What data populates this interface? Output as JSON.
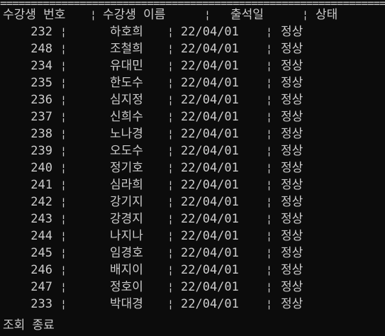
{
  "header": {
    "rule": "======================================================================================================",
    "col_id": "수강생 번호",
    "col_name": "수강생 이름",
    "col_date": "출석일",
    "col_status": "상태",
    "sep": "¦"
  },
  "rows": [
    {
      "id": "232",
      "name": "하호희",
      "date": "22/04/01",
      "status": "정상"
    },
    {
      "id": "248",
      "name": "조철희",
      "date": "22/04/01",
      "status": "정상"
    },
    {
      "id": "234",
      "name": "유대민",
      "date": "22/04/01",
      "status": "정상"
    },
    {
      "id": "235",
      "name": "한도수",
      "date": "22/04/01",
      "status": "정상"
    },
    {
      "id": "236",
      "name": "심지정",
      "date": "22/04/01",
      "status": "정상"
    },
    {
      "id": "237",
      "name": "신희수",
      "date": "22/04/01",
      "status": "정상"
    },
    {
      "id": "238",
      "name": "노나경",
      "date": "22/04/01",
      "status": "정상"
    },
    {
      "id": "239",
      "name": "오도수",
      "date": "22/04/01",
      "status": "정상"
    },
    {
      "id": "240",
      "name": "정기호",
      "date": "22/04/01",
      "status": "정상"
    },
    {
      "id": "241",
      "name": "심라희",
      "date": "22/04/01",
      "status": "정상"
    },
    {
      "id": "242",
      "name": "강기지",
      "date": "22/04/01",
      "status": "정상"
    },
    {
      "id": "243",
      "name": "강경지",
      "date": "22/04/01",
      "status": "정상"
    },
    {
      "id": "244",
      "name": "나지나",
      "date": "22/04/01",
      "status": "정상"
    },
    {
      "id": "245",
      "name": "임경호",
      "date": "22/04/01",
      "status": "정상"
    },
    {
      "id": "246",
      "name": "배지이",
      "date": "22/04/01",
      "status": "정상"
    },
    {
      "id": "247",
      "name": "정호이",
      "date": "22/04/01",
      "status": "정상"
    },
    {
      "id": "233",
      "name": "박대경",
      "date": "22/04/01",
      "status": "정상"
    }
  ],
  "footer": {
    "message": "조회 종료"
  }
}
